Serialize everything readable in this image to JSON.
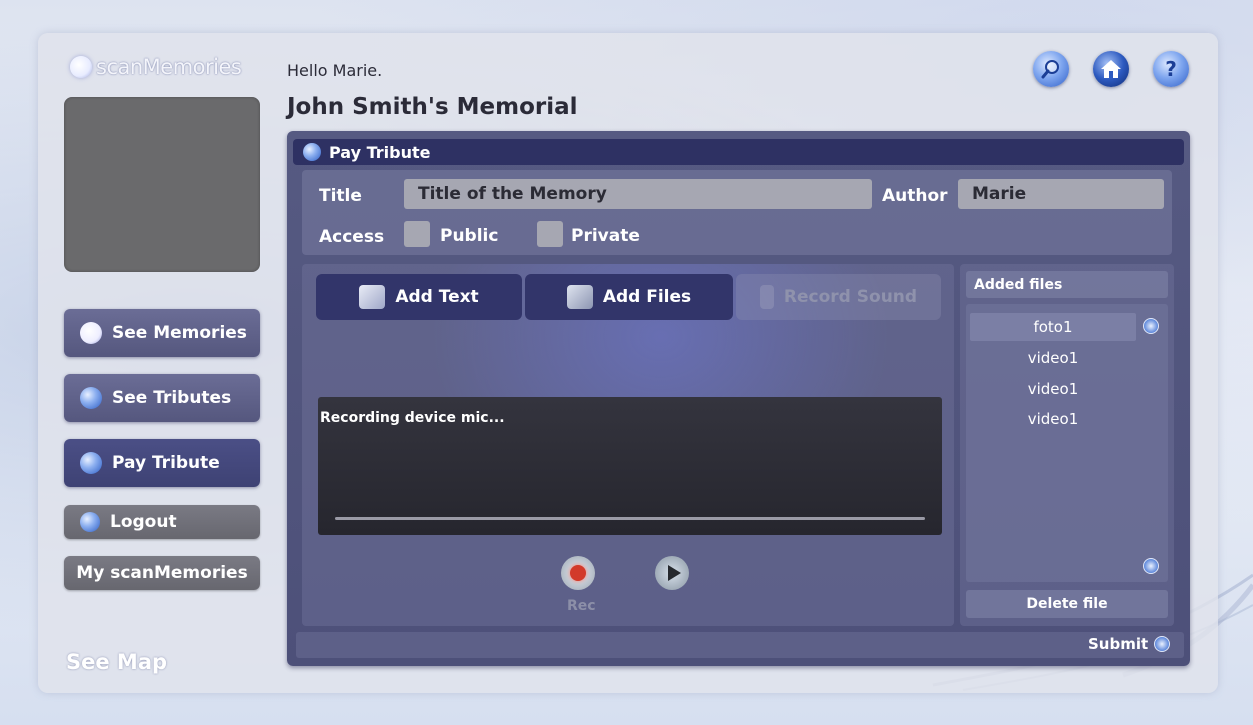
{
  "brand": {
    "logo_text": "scanMemories"
  },
  "header": {
    "greeting": "Hello Marie.",
    "memorial_title": "John Smith's Memorial"
  },
  "top_icons": [
    "search-icon",
    "home-icon",
    "help-icon"
  ],
  "help_glyph": "?",
  "sidebar": {
    "items": [
      {
        "label": "See Memories",
        "icon": "memories-icon"
      },
      {
        "label": "See Tributes",
        "icon": "tributes-icon"
      },
      {
        "label": "Pay Tribute",
        "icon": "tribute-icon",
        "active": true
      },
      {
        "label": "Logout",
        "icon": "logout-icon"
      },
      {
        "label": "My scanMemories"
      }
    ],
    "see_map": "See Map"
  },
  "panel": {
    "title": "Pay Tribute",
    "form": {
      "title_label": "Title",
      "title_value": "Title of the Memory",
      "author_label": "Author",
      "author_value": "Marie",
      "access_label": "Access",
      "public_label": "Public",
      "private_label": "Private"
    },
    "tabs": [
      {
        "label": "Add Text"
      },
      {
        "label": "Add Files"
      },
      {
        "label": "Record Sound",
        "disabled": true
      }
    ],
    "recorder": {
      "status": "Recording device mic...",
      "rec_label": "Rec"
    },
    "files": {
      "header": "Added files",
      "items": [
        "foto1",
        "video1",
        "video1",
        "video1"
      ],
      "delete_label": "Delete file"
    },
    "submit_label": "Submit"
  },
  "colors": {
    "panel_bg": "#51547d",
    "header_bar": "#2e3163",
    "tab_active": "#32356a",
    "field_bg": "#a6a7b2",
    "rec_red": "#d23a2a"
  }
}
